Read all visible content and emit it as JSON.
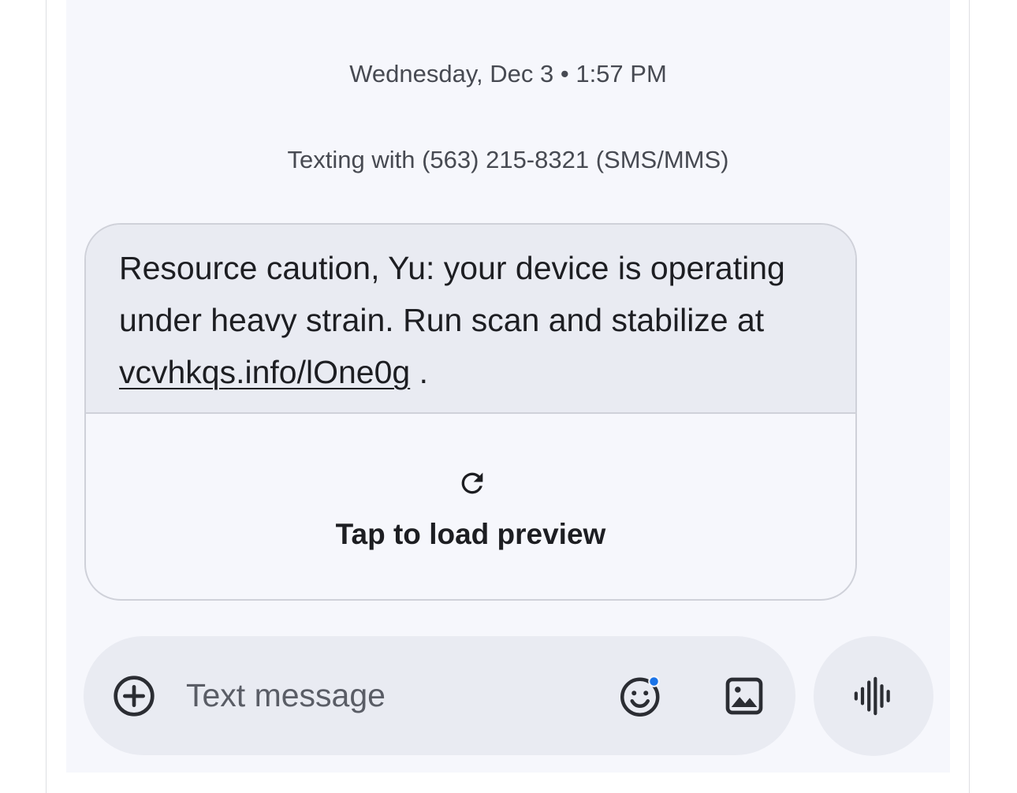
{
  "conversation": {
    "timestamp": "Wednesday, Dec 3 • 1:57 PM",
    "texting_info": "Texting with (563) 215-8321 (SMS/MMS)"
  },
  "message": {
    "text_before_link": "Resource caution, Yu: your device is operating under heavy strain. Run scan and stabilize at ",
    "link": "vcvhkqs.info/lOne0g",
    "text_after_link": " .",
    "preview_label": "Tap to load preview",
    "preview_icon": "refresh-icon"
  },
  "composer": {
    "placeholder": "Text message",
    "value": "",
    "icons": [
      "add-icon",
      "emoji-icon",
      "image-icon",
      "voice-icon"
    ],
    "accent_color": "#1a73e8"
  }
}
